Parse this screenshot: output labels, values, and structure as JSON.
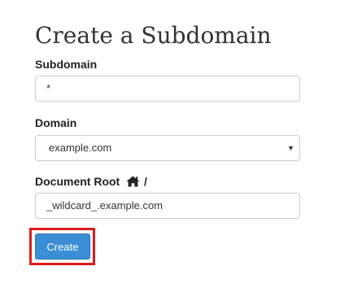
{
  "page": {
    "title": "Create a Subdomain"
  },
  "form": {
    "subdomain": {
      "label": "Subdomain",
      "value": "*"
    },
    "domain": {
      "label": "Domain",
      "selected": "example.com"
    },
    "document_root": {
      "label": "Document Root",
      "suffix": "/",
      "icon": "home-icon",
      "value": "_wildcard_.example.com"
    },
    "create_label": "Create"
  },
  "colors": {
    "button": "#3a8ed6",
    "highlight": "#e01b1b"
  }
}
